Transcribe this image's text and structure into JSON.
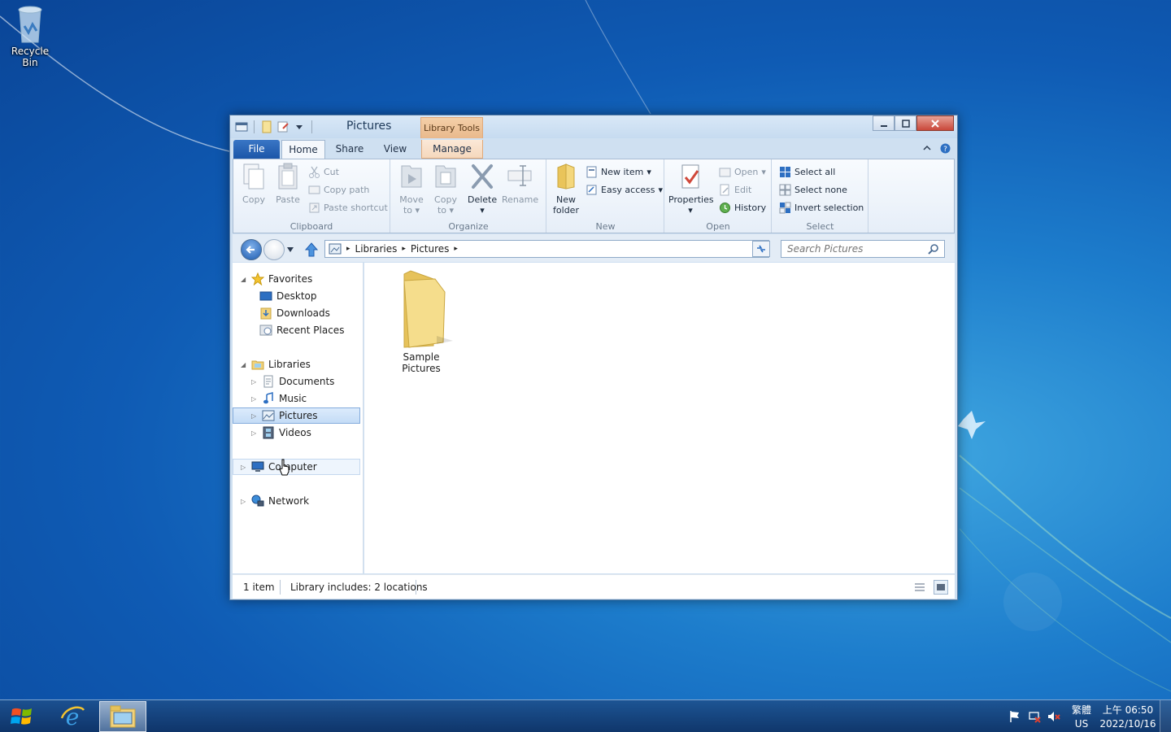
{
  "desktop": {
    "recycle_bin": "Recycle Bin"
  },
  "window": {
    "title": "Pictures",
    "context_tab": "Library Tools",
    "tabs": {
      "file": "File",
      "home": "Home",
      "share": "Share",
      "view": "View",
      "manage": "Manage"
    }
  },
  "ribbon": {
    "clipboard": {
      "label": "Clipboard",
      "copy": "Copy",
      "paste": "Paste",
      "cut": "Cut",
      "copy_path": "Copy path",
      "paste_shortcut": "Paste shortcut"
    },
    "organize": {
      "label": "Organize",
      "move_to_1": "Move",
      "move_to_2": "to",
      "copy_to_1": "Copy",
      "copy_to_2": "to",
      "delete": "Delete",
      "rename": "Rename"
    },
    "new": {
      "label": "New",
      "new_folder_1": "New",
      "new_folder_2": "folder",
      "new_item": "New item",
      "easy_access": "Easy access"
    },
    "open": {
      "label": "Open",
      "properties": "Properties",
      "open": "Open",
      "edit": "Edit",
      "history": "History"
    },
    "select": {
      "label": "Select",
      "select_all": "Select all",
      "select_none": "Select none",
      "invert_selection": "Invert selection"
    }
  },
  "address": {
    "crumbs": [
      "Libraries",
      "Pictures"
    ],
    "search_placeholder": "Search Pictures"
  },
  "nav": {
    "favorites": "Favorites",
    "desktop": "Desktop",
    "downloads": "Downloads",
    "recent_places": "Recent Places",
    "libraries": "Libraries",
    "documents": "Documents",
    "music": "Music",
    "pictures": "Pictures",
    "videos": "Videos",
    "computer": "Computer",
    "network": "Network"
  },
  "content": {
    "items": [
      {
        "name": "Sample Pictures"
      }
    ]
  },
  "status": {
    "count": "1 item",
    "library_info": "Library includes: 2 locations"
  },
  "taskbar": {
    "ime_top": "繁體",
    "ime_bottom": "US",
    "time": "上午 06:50",
    "date": "2022/10/16"
  },
  "colors": {
    "accent": "#1b56a8",
    "folder": "#f2d27a",
    "selection": "#c4dcf6"
  }
}
